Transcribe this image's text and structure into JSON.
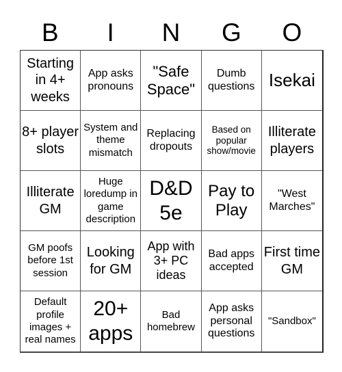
{
  "title_letters": [
    "B",
    "I",
    "N",
    "G",
    "O"
  ],
  "cells": [
    "Starting in 4+ weeks",
    "App asks pronouns",
    "\"Safe Space\"",
    "Dumb questions",
    "Isekai",
    "8+ player slots",
    "System and theme mismatch",
    "Replacing dropouts",
    "Based on popular show/movie",
    "Illiterate players",
    "Illiterate GM",
    "Huge loredump in game description",
    "D&D 5e",
    "Pay to Play",
    "\"West Marches\"",
    "GM poofs before 1st session",
    "Looking for GM",
    "App with 3+ PC ideas",
    "Bad apps accepted",
    "First time GM",
    "Default profile images + real names",
    "20+ apps",
    "Bad homebrew",
    "App asks personal questions",
    "\"Sandbox\""
  ]
}
